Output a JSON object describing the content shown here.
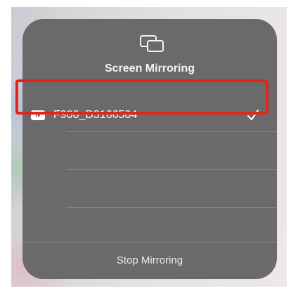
{
  "panel": {
    "title": "Screen Mirroring",
    "icon": "screen-mirroring-icon"
  },
  "devices": [
    {
      "badge": "tv",
      "badge_icon": "apple-tv-icon",
      "name": "F900_D3166504",
      "selected": true,
      "check_icon": "checkmark-icon"
    }
  ],
  "footer": {
    "stop_label": "Stop Mirroring"
  },
  "colors": {
    "panel_bg": "#6a6a6a",
    "highlight": "#e3241b",
    "text": "#ffffff"
  }
}
